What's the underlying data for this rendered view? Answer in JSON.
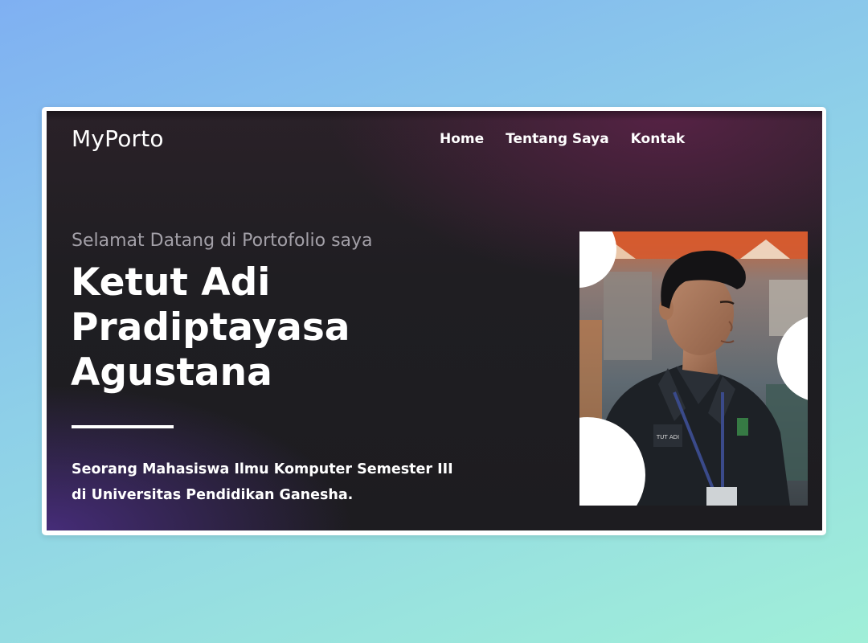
{
  "brand": "MyPorto",
  "nav": {
    "home": "Home",
    "about": "Tentang Saya",
    "contact": "Kontak"
  },
  "hero": {
    "greeting": "Selamat Datang di Portofolio saya",
    "name_lines": [
      "Ketut Adi",
      "Pradiptayasa",
      "Agustana"
    ],
    "description_lines": [
      "Seorang Mahasiswa Ilmu Komputer Semester III",
      "di Universitas Pendidikan Ganesha."
    ]
  },
  "photo": {
    "badge_text": "TUT ADI"
  },
  "colors": {
    "page_bg_start": "#7fb0f2",
    "page_bg_end": "#a0efd8",
    "hero_bg": "#1f1e22",
    "hero_accent_top": "#5e224a",
    "hero_accent_bottom": "#4a2e82",
    "greeting_text": "#a3a0a8",
    "text": "#ffffff"
  }
}
